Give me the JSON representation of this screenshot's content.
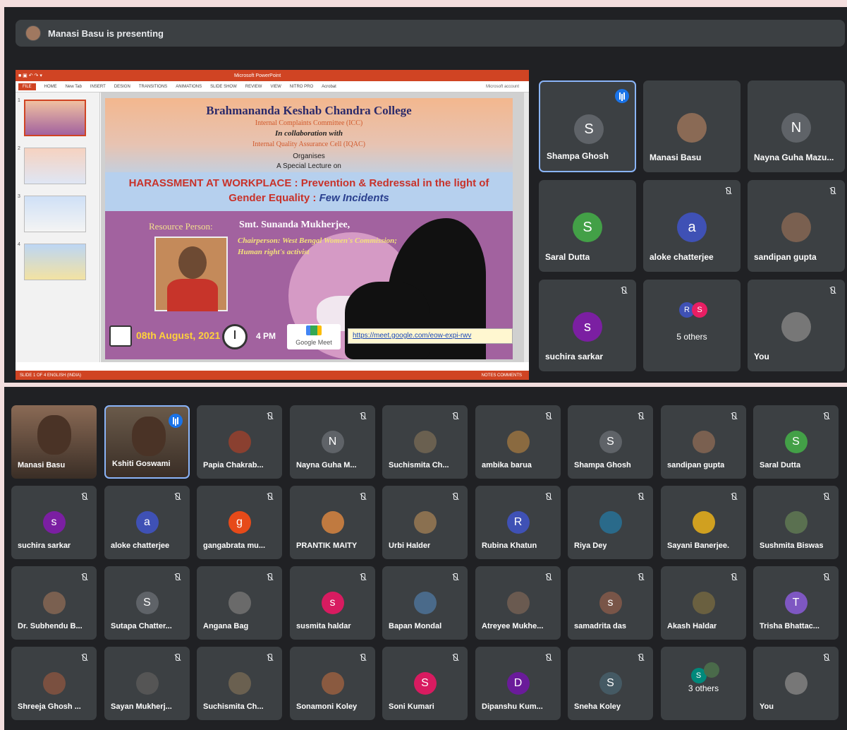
{
  "presenting": {
    "text": "Manasi Basu is presenting",
    "avatar_icon": "user-photo"
  },
  "ppt": {
    "title": "Microsoft PowerPoint",
    "ribbon_tabs": [
      "FILE",
      "HOME",
      "New Tab",
      "INSERT",
      "DESIGN",
      "TRANSITIONS",
      "ANIMATIONS",
      "SLIDE SHOW",
      "REVIEW",
      "VIEW",
      "NITRO PRO",
      "Acrobat"
    ],
    "account": "Microsoft account",
    "thumb_numbers": [
      "1",
      "2",
      "3",
      "4"
    ],
    "status_left": "SLIDE 1 OF 4     ENGLISH (INDIA)",
    "status_right": "NOTES    COMMENTS"
  },
  "slide": {
    "college": "Brahmananda Keshab Chandra College",
    "icc": "Internal Complaints Committee (ICC)",
    "collab": "In collaboration with",
    "iqac": "Internal Quality Assurance Cell  (IQAC)",
    "organises": "Organises",
    "special": "A Special Lecture on",
    "headline_1": "HARASSMENT AT WORKPLACE : Prevention & Redressal in the light of",
    "headline_2": "Gender Equality :",
    "headline_2_italic": "Few Incidents",
    "resource_label": "Resource Person:",
    "resource_name": "Smt. Sunanda Mukherjee,",
    "chair": "Chairperson: West Bengal Women's Commission;",
    "human": "Human right's activist",
    "date": "08th August, 2021",
    "time": "4 PM",
    "gmeet_label": "Google Meet",
    "link": "https://meet.google.com/eow-expi-rwv"
  },
  "top_tiles": [
    {
      "name": "Shampa Ghosh",
      "initial": "S",
      "color": "#5f6368",
      "speaking": true
    },
    {
      "name": "Manasi Basu",
      "initial": "",
      "color": "#8a6a55",
      "photo": true
    },
    {
      "name": "Nayna Guha Mazu...",
      "initial": "N",
      "color": "#5f6368"
    },
    {
      "name": "Saral Dutta",
      "initial": "S",
      "color": "#43a047"
    },
    {
      "name": "aloke chatterjee",
      "initial": "a",
      "color": "#3f51b5",
      "muted": true
    },
    {
      "name": "sandipan gupta",
      "initial": "",
      "color": "#7a6050",
      "photo": true,
      "muted": true
    },
    {
      "name": "suchira sarkar",
      "initial": "s",
      "color": "#7b1fa2",
      "muted": true
    },
    {
      "name": "5 others",
      "others": [
        "R",
        "S"
      ],
      "others_colors": [
        "#3f51b5",
        "#e91e63"
      ]
    },
    {
      "name": "You",
      "initial": "",
      "color": "#777",
      "photo": true,
      "muted": true
    }
  ],
  "bottom_tiles": [
    {
      "name": "Manasi Basu",
      "photo": true,
      "color": "#8a6a55",
      "large": true
    },
    {
      "name": "Kshiti Goswami",
      "photo": true,
      "color": "#6a5a4a",
      "large": true,
      "speaking": true
    },
    {
      "name": "Papia Chakrab...",
      "photo": true,
      "color": "#8a4030",
      "muted": true
    },
    {
      "name": "Nayna Guha M...",
      "initial": "N",
      "color": "#5f6368",
      "muted": true
    },
    {
      "name": "Suchismita Ch...",
      "photo": true,
      "color": "#6a6050",
      "muted": true
    },
    {
      "name": "ambika barua",
      "photo": true,
      "color": "#8a6a40",
      "muted": true
    },
    {
      "name": "Shampa Ghosh",
      "initial": "S",
      "color": "#5f6368",
      "muted": true
    },
    {
      "name": "sandipan gupta",
      "photo": true,
      "color": "#7a6050",
      "muted": true
    },
    {
      "name": "Saral Dutta",
      "initial": "S",
      "color": "#43a047",
      "muted": true
    },
    {
      "name": "suchira sarkar",
      "initial": "s",
      "color": "#7b1fa2",
      "muted": true
    },
    {
      "name": "aloke chatterjee",
      "initial": "a",
      "color": "#3f51b5",
      "muted": true
    },
    {
      "name": "gangabrata mu...",
      "initial": "g",
      "color": "#e64a19",
      "muted": true
    },
    {
      "name": "PRANTIK MAITY",
      "photo": true,
      "color": "#c07a40",
      "muted": true
    },
    {
      "name": "Urbi Halder",
      "photo": true,
      "color": "#8a7050",
      "muted": true
    },
    {
      "name": "Rubina Khatun",
      "initial": "R",
      "color": "#3f51b5",
      "muted": true
    },
    {
      "name": "Riya Dey",
      "photo": true,
      "color": "#2a6a8a",
      "muted": true
    },
    {
      "name": "Sayani Banerjee.",
      "photo": true,
      "color": "#d0a020",
      "muted": true
    },
    {
      "name": "Sushmita Biswas",
      "photo": true,
      "color": "#5a7050",
      "muted": true
    },
    {
      "name": "Dr. Subhendu B...",
      "photo": true,
      "color": "#7a6050",
      "muted": true
    },
    {
      "name": "Sutapa Chatter...",
      "initial": "S",
      "color": "#5f6368",
      "muted": true
    },
    {
      "name": "Angana Bag",
      "photo": true,
      "color": "#6a6a6a",
      "muted": true
    },
    {
      "name": "susmita haldar",
      "initial": "s",
      "color": "#d81b60",
      "muted": true
    },
    {
      "name": "Bapan Mondal",
      "photo": true,
      "color": "#4a6a8a",
      "muted": true
    },
    {
      "name": "Atreyee Mukhe...",
      "photo": true,
      "color": "#6a5a50",
      "muted": true
    },
    {
      "name": "samadrita das",
      "initial": "s",
      "color": "#795548",
      "muted": true
    },
    {
      "name": "Akash Haldar",
      "photo": true,
      "color": "#6a6040",
      "muted": true
    },
    {
      "name": "Trisha Bhattac...",
      "initial": "T",
      "color": "#7e57c2",
      "muted": true
    },
    {
      "name": "Shreeja Ghosh ...",
      "photo": true,
      "color": "#7a5040",
      "muted": true
    },
    {
      "name": "Sayan Mukherj...",
      "photo": true,
      "color": "#555555",
      "muted": true
    },
    {
      "name": "Suchismita Ch...",
      "photo": true,
      "color": "#6a6050",
      "muted": true
    },
    {
      "name": "Sonamoni Koley",
      "photo": true,
      "color": "#8a5a40",
      "muted": true
    },
    {
      "name": "Soni Kumari",
      "initial": "S",
      "color": "#d81b60",
      "muted": true
    },
    {
      "name": "Dipanshu Kum...",
      "initial": "D",
      "color": "#6a1b9a",
      "muted": true
    },
    {
      "name": "Sneha Koley",
      "initial": "S",
      "color": "#455a64",
      "muted": true
    },
    {
      "name": "3 others",
      "others": [
        "S",
        ""
      ],
      "others_colors": [
        "#00897b",
        "#4a6a4a"
      ]
    },
    {
      "name": "You",
      "photo": true,
      "color": "#777777",
      "muted": true
    }
  ]
}
